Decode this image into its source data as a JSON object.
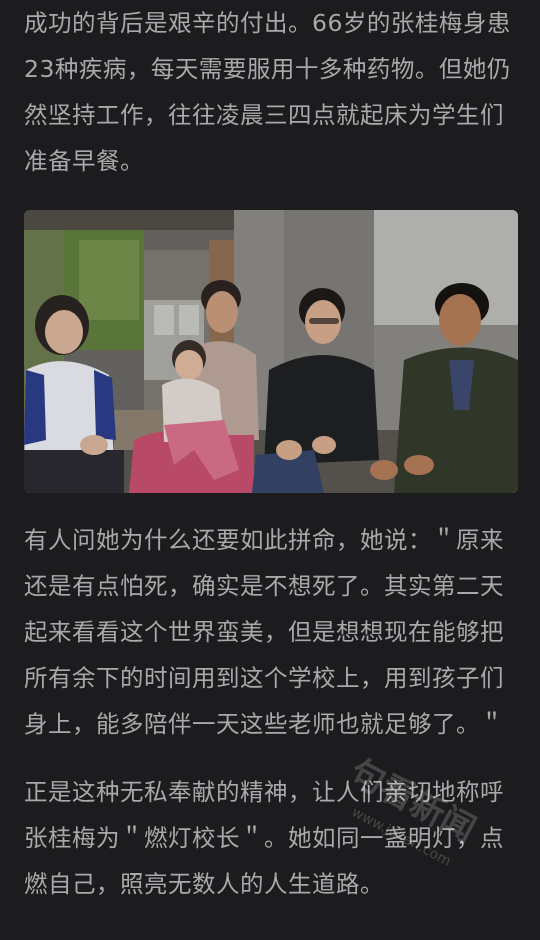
{
  "article": {
    "paragraph_1": "成功的背后是艰辛的付出。66岁的张桂梅身患23种疾病，每天需要服用十多种药物。但她仍然坚持工作，往往凌晨三四点就起床为学生们准备早餐。",
    "paragraph_2": "有人问她为什么还要如此拼命，她说：＂原来还是有点怕死，确实是不想死了。其实第二天起来看看这个世界蛮美，但是想想现在能够把所有余下的时间用到这个学校上，用到孩子们身上，能多陪伴一天这些老师也就足够了。＂",
    "paragraph_3": "正是这种无私奉献的精神，让人们亲切地称呼张桂梅为＂燃灯校长＂。她如同一盏明灯，点燃自己，照亮无数人的人生道路。"
  },
  "watermark": {
    "text": "句看新闻",
    "sub": "www.jukan.com"
  }
}
